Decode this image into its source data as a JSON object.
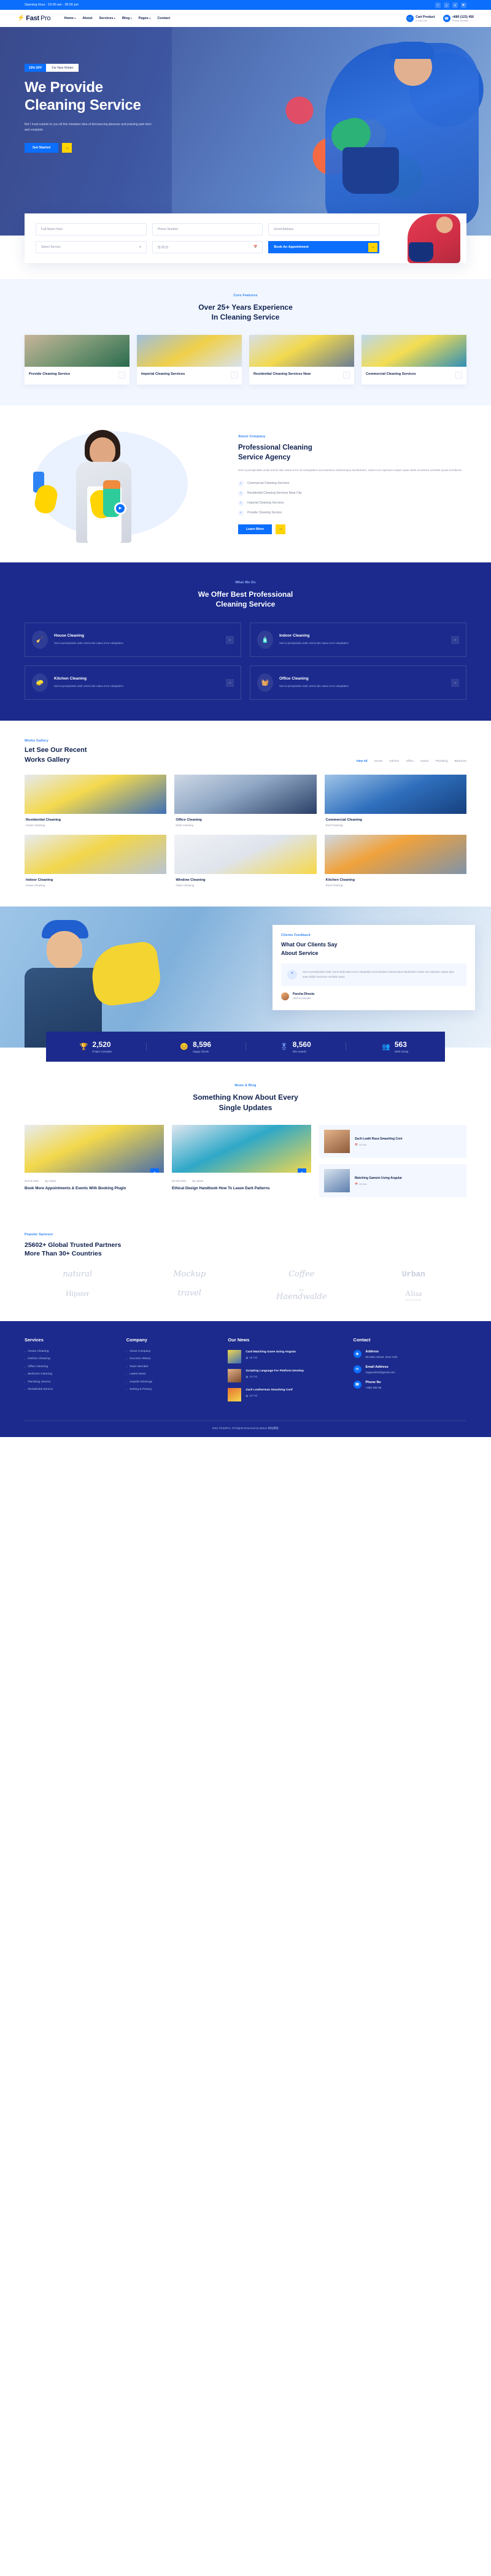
{
  "topbar": {
    "hours": "Opening Hour : 10:00 am - 05:00 pm",
    "socials": [
      "facebook-icon",
      "twitter-icon",
      "linkedin-icon",
      "youtube-icon"
    ],
    "social_glyphs": [
      "f",
      "у",
      "in",
      "▶"
    ]
  },
  "header": {
    "logo_bolt": "⚡",
    "logo_fast": "Fast",
    "logo_pro": "Pro",
    "nav": [
      {
        "label": "Home",
        "has_caret": true
      },
      {
        "label": "About",
        "has_caret": false
      },
      {
        "label": "Services",
        "has_caret": true
      },
      {
        "label": "Blog",
        "has_caret": true
      },
      {
        "label": "Pages",
        "has_caret": true
      },
      {
        "label": "Contact",
        "has_caret": false
      }
    ],
    "cart": {
      "title": "Cart Product",
      "sub": "0 Cart List",
      "icon": "cart-icon"
    },
    "phone": {
      "title": "+880 (123) 456",
      "sub": "Phone Number",
      "icon": "phone-icon"
    }
  },
  "hero": {
    "badge_off": "10% OFF",
    "badge_holder": "For New Holder",
    "title_line1": "We Provide",
    "title_line2": "Cleaning Service",
    "paragraph": "But I must explain to you all this mistaken idea of denouncing pleasure and praising pain born and complete",
    "cta": "Get Started",
    "cta_arrow": "→"
  },
  "booking": {
    "name_placeholder": "Full Name Hare",
    "phone_placeholder": "Phone Number",
    "email_placeholder": "Email Addrass",
    "service_placeholder": "Select Service",
    "service_caret": "⌄",
    "date_placeholder": "年/月/日",
    "date_icon": "calendar-icon",
    "submit": "Book An Appointment",
    "submit_arrow": "→"
  },
  "features": {
    "eyebrow": "Core Features",
    "title_line1": "Over 25+ Years Experience",
    "title_line2": "In Cleaning Service",
    "cards": [
      {
        "title": "Provide Cleaning Service",
        "arrow": "→"
      },
      {
        "title": "Imperial Cleaning Services",
        "arrow": "→"
      },
      {
        "title": "Residential Cleaning Services Near",
        "arrow": "→"
      },
      {
        "title": "Commercial Cleaning Services",
        "arrow": "→"
      }
    ]
  },
  "about": {
    "eyebrow": "About Company",
    "title_line1": "Professional Cleaning",
    "title_line2": "Service Agency",
    "lead": "Sed ut perspiciatis unde omnis iste natus error sit voluptatem accusantium doloremque laudantium, totam rem aperiam eaque quae abilo inventore veritatis quasi architecto",
    "checks": [
      "Commercial Cleaning Services",
      "Residential Cleaning Services Near City",
      "Imperial Cleaning Services",
      "Provide Cleaning Service"
    ],
    "check_glyph": "✓",
    "cta": "Learn More",
    "cta_arrow": "→",
    "play_icon": "play-icon",
    "play_glyph": "▶"
  },
  "whatwedo": {
    "eyebrow": "What We Do",
    "title_line1": "We Offer Best Professional",
    "title_line2": "Cleaning Service",
    "cards": [
      {
        "title": "House Cleaning",
        "desc": "Sed ut perspiciatis unde omnis iste natus error voluptatem",
        "icon": "broom-icon",
        "glyph": "🧹",
        "arrow": "→"
      },
      {
        "title": "Indoor Cleaning",
        "desc": "Sed ut perspiciatis unde omnis iste natus error voluptatem",
        "icon": "spray-bottle-icon",
        "glyph": "🧴",
        "arrow": "→"
      },
      {
        "title": "Kitchen Cleaning",
        "desc": "Sed ut perspiciatis unde omnis iste natus error voluptatem",
        "icon": "sink-icon",
        "glyph": "🧽",
        "arrow": "→"
      },
      {
        "title": "Office Cleaning",
        "desc": "Sed ut perspiciatis unde omnis iste natus error voluptatem",
        "icon": "vacuum-icon",
        "glyph": "🧺",
        "arrow": "→"
      }
    ]
  },
  "gallery": {
    "eyebrow": "Works Gallery",
    "title_line1": "Let See Our Recent",
    "title_line2": "Works Gallery",
    "filters": [
      "View All",
      "House",
      "Kitchen",
      "Office",
      "Indoor",
      "Plumbing",
      "Bedroom"
    ],
    "active_filter": "View All",
    "items": [
      {
        "title": "Residential Cleaning",
        "sub": "House Cleaning"
      },
      {
        "title": "Office Cleaning",
        "sub": "Desk Cleaning"
      },
      {
        "title": "Commercial Cleaning",
        "sub": "Roof Cleaning"
      },
      {
        "title": "Indoor Cleaning",
        "sub": "House Cleaning"
      },
      {
        "title": "Window Cleaning",
        "sub": "Glass Cleaning"
      },
      {
        "title": "Kitchen Cleaning",
        "sub": "Roof Cleaning"
      }
    ]
  },
  "testimonial": {
    "eyebrow": "Clients Feedback",
    "title_line1": "What Our Clients Say",
    "title_line2": "About Service",
    "quote_glyph": "“",
    "quote": "Sed ut perspiciatis unde omnis lady tatus error voluptatem accusantium doloremque laudantium totam rem aperiam eaque ipsa quae abillo inventore veritatis quasi",
    "author_name": "Parsha Dhosta",
    "author_role": "CEO & Founder",
    "prev": "←",
    "next": "→"
  },
  "counters": [
    {
      "value": "2,520",
      "label": "Project Complete",
      "icon": "project-icon",
      "glyph": "🏆"
    },
    {
      "value": "8,596",
      "label": "Happy Clients",
      "icon": "clients-icon",
      "glyph": "😊"
    },
    {
      "value": "8,560",
      "label": "Win Awards",
      "icon": "awards-icon",
      "glyph": "🎖"
    },
    {
      "value": "563",
      "label": "Work Group",
      "icon": "team-icon",
      "glyph": "👥"
    }
  ],
  "blog": {
    "eyebrow": "News & Blog",
    "title_line1": "Something Know About Every",
    "title_line2": "Single Updates",
    "posts": [
      {
        "title": "Book More Appointments & Events With Booking Plugin",
        "date": "25 Feb 2021",
        "author": "By Admin",
        "plus": "+"
      },
      {
        "title": "Ethical Design Handbook How To Leave Dark Patterns",
        "date": "25 Feb 2021",
        "author": "By Admin",
        "plus": "+"
      }
    ],
    "side_posts": [
      {
        "title": "Zach Leath Rasa Smashing Coni",
        "date": "25 Feb"
      },
      {
        "title": "Matching Gamein Using Angular",
        "date": "25 Feb"
      }
    ]
  },
  "partners": {
    "eyebrow": "Popular Sponsor",
    "title_line1": "25602+ Global Trusted Partners",
    "title_line2": "More Than 30+ Countries",
    "logos": [
      {
        "text": "natural",
        "style": "script"
      },
      {
        "text": "Mockup",
        "style": "script"
      },
      {
        "text": "Coffee",
        "style": "script"
      },
      {
        "text": "Urban",
        "style": "mono"
      },
      {
        "text": "Hipster",
        "style": "serif"
      },
      {
        "text": "travel",
        "style": "script"
      },
      {
        "text": "Haendwalde",
        "style": "script",
        "sub": "the"
      },
      {
        "text": "Alisa",
        "style": "serif",
        "sub": "BOUTIQUE"
      }
    ]
  },
  "footer": {
    "columns": [
      {
        "heading": "Services",
        "links": [
          "House Cleaning",
          "Kitchen Cleaning",
          "Office Cleaning",
          "Bedroom Cleaning",
          "Plumbing Service",
          "Residential Service"
        ]
      },
      {
        "heading": "Company",
        "links": [
          "About Company",
          "Success History",
          "Team Member",
          "Latest News",
          "Awards Winnings",
          "Setting & Privacy"
        ]
      }
    ],
    "news_heading": "Our News",
    "news": [
      {
        "title": "Card Matching Game Using Angular",
        "date": "25 Feb"
      },
      {
        "title": "Scripting Language For Platform Develop",
        "date": "25 Feb"
      },
      {
        "title": "Zach Leatherman Smashing Conf",
        "date": "25 Feb"
      }
    ],
    "contact_heading": "Contact",
    "contacts": [
      {
        "title": "Address",
        "value": "55 Main Street, New York",
        "icon": "location-icon",
        "glyph": "◉"
      },
      {
        "title": "Email Address",
        "value": "supportinfo@gmail.com",
        "icon": "envelope-icon",
        "glyph": "✉"
      },
      {
        "title": "Phone No",
        "value": "+880 456 99",
        "icon": "phone-icon",
        "glyph": "☎"
      }
    ],
    "copyright": "2021 ©FastPro. All Rights Reserved by Bdevs 网站模板",
    "link_chevron": "›",
    "date_icon": "calendar-icon",
    "date_glyph": "▦"
  }
}
